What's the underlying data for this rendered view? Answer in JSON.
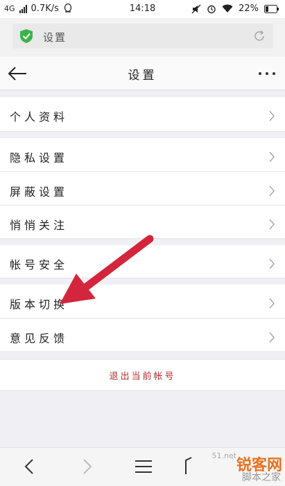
{
  "status_bar": {
    "network": "4G",
    "speed": "0.7K/s",
    "time": "14:18",
    "battery": "22%"
  },
  "url_bar": {
    "text": "设置"
  },
  "header": {
    "title": "设置"
  },
  "menu": {
    "profile": "个人资料",
    "privacy": "隐私设置",
    "block": "屏蔽设置",
    "follow": "悄悄关注",
    "account_security": "帐号安全",
    "version_switch": "版本切换",
    "feedback": "意见反馈"
  },
  "logout_label": "退出当前帐号",
  "watermark": {
    "brand": "锐客网",
    "sub": "脚本之家",
    "url_fragment": "51.net"
  },
  "colors": {
    "accent_red": "#b0302c",
    "arrow_red": "#d3263c",
    "shield_green": "#3cb34a"
  }
}
